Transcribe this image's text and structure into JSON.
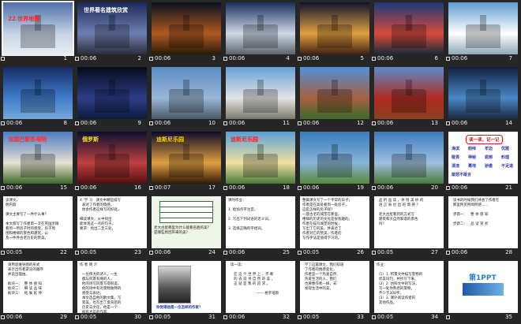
{
  "slides": [
    {
      "num": "1",
      "time": "",
      "title": "22.世界地理",
      "title_color": "#ff2020",
      "bg": [
        "#4e6fa8",
        "#c6d4e6",
        "#e9ecef"
      ]
    },
    {
      "num": "2",
      "time": "00:06",
      "title": "世界著名建筑欣赏",
      "title_color": "#ffffff",
      "bg": [
        "#1b2a5a",
        "#6f7fb1",
        "#2b2e3a"
      ]
    },
    {
      "num": "3",
      "time": "00:06",
      "bg": [
        "#08101f",
        "#b05a20",
        "#2a1a0a"
      ]
    },
    {
      "num": "4",
      "time": "00:06",
      "bg": [
        "#18305e",
        "#cfd8e7",
        "#5c636b"
      ]
    },
    {
      "num": "5",
      "time": "00:06",
      "bg": [
        "#0c1330",
        "#e0a040",
        "#402010"
      ]
    },
    {
      "num": "6",
      "time": "00:06",
      "bg": [
        "#1a3a7a",
        "#d84a3a",
        "#1a2a3a"
      ]
    },
    {
      "num": "7",
      "time": "00:06",
      "bg": [
        "#5f9ccf",
        "#ffffff",
        "#8fa9b8"
      ]
    },
    {
      "num": "8",
      "time": "00:06",
      "bg": [
        "#162c66",
        "#3f7ccc",
        "#78a8d8"
      ]
    },
    {
      "num": "9",
      "time": "00:06",
      "bg": [
        "#050b1a",
        "#2d3d8a",
        "#0d1a3a"
      ]
    },
    {
      "num": "10",
      "time": "00:06",
      "bg": [
        "#5a8cc4",
        "#9ab6d6",
        "#4a5a6a"
      ]
    },
    {
      "num": "11",
      "time": "00:06",
      "bg": [
        "#66a0d8",
        "#e4e4e4",
        "#7a7a6a"
      ]
    },
    {
      "num": "12",
      "time": "00:06",
      "bg": [
        "#4f90d8",
        "#a76040",
        "#3a6a2a"
      ]
    },
    {
      "num": "13",
      "time": "00:06",
      "bg": [
        "#5b8ccb",
        "#b02a20",
        "#8a4020"
      ]
    },
    {
      "num": "14",
      "time": "00:06",
      "bg": [
        "#102040",
        "#4a88c8",
        "#1a2840"
      ]
    },
    {
      "num": "15",
      "time": "00:06",
      "title": "法国巴黎圣母院",
      "title_color": "#ff2a2a",
      "bg": [
        "#4b7cc4",
        "#e8e0d0",
        "#3a6a2a"
      ]
    },
    {
      "num": "16",
      "time": "00:06",
      "title": "俄罗斯",
      "title_color": "#ffe000",
      "bg": [
        "#0a1030",
        "#c04040",
        "#501010"
      ]
    },
    {
      "num": "17",
      "time": "00:07",
      "title": "迪斯尼乐园",
      "title_color": "#ffd000",
      "bg": [
        "#0a0a28",
        "#e0a040",
        "#301808"
      ]
    },
    {
      "num": "18",
      "time": "00:06",
      "title": "迪斯尼乐园",
      "title_color": "#ff2020",
      "bg": [
        "#5aa0d8",
        "#f0e0a0",
        "#4a7a3a"
      ]
    },
    {
      "num": "19",
      "time": "00:06",
      "bg": [
        "#3b7abe",
        "#86b4d8",
        "#5a8a3a"
      ]
    },
    {
      "num": "20",
      "time": "00:06",
      "bg": [
        "#3b7abe",
        "#9ec0e0",
        "#4a7a3a"
      ]
    },
    {
      "num": "21",
      "time": "00:06",
      "type": "words",
      "head": "读一读，记一记",
      "words": [
        "海滨",
        "韵味",
        "年迈",
        "优雅",
        "敬畏",
        "神秘",
        "遐想",
        "料理",
        "漂流",
        "蓦地",
        "骄傲",
        "不足道",
        "敢怒不敢言"
      ]
    },
    {
      "num": "22",
      "time": "00:05",
      "type": "text",
      "text": "读课文，\n明内容\n\n课文主要写了一件什么事？\n\n本文叙写了作者第一次在英国亲眼\n看到一所房子时的感受，房子周\n围和楼梯的景色和建筑，以\n及一件件古老历史的赞美。"
    },
    {
      "num": "23",
      "time": "00:05",
      "type": "text",
      "text": "4. 学 习   课文中哪些描写\n  表达了作者的情感，\n  体会作者这样写的好处。\n\n细读课文，从中找出\n能体现这一点的句子。\n要求：找出二至三处。"
    },
    {
      "num": "24",
      "time": "00:06",
      "type": "table",
      "text": "老大古屋哪里为什么能看名胜的美？\n是哪些原因带来的美？"
    },
    {
      "num": "25",
      "time": "00:06",
      "type": "text",
      "text": "课时作业：\n\n1. 给加点字注音。\n\n2. 写出下列词语的近义词。\n\n3. 选择正确的字组词。"
    },
    {
      "num": "26",
      "time": "00:05",
      "type": "text",
      "text": "整篇课文写了一个平常的日子，\n作者是在高处看到一处房子，\n这是怎样的房子呢？\n一座古老的城堡在那里。\n楼梯的历史的文化是很有趣的。\n作者在描写城堡的时候，\n写出了它的美，并表达了\n作者对它的赞美，作者的\n写作手法是值得学习的。"
    },
    {
      "num": "27",
      "time": "00:05",
      "type": "text",
      "text": "  品 析 品 读 ，体 悟 美 妙 的\n  语 言 表 达 出 的 情 感 ？\n\n  老大古屋看到的方式写\n  建筑和大自然和谐的景色\n  吗？"
    },
    {
      "num": "28",
      "time": "00:06",
      "type": "text",
      "text": "  读书的时候我们体会了作者在\n  那里所见所闻所感……\n\n  步骤一：   整 体 感 知\n\n  步骤二：   品 读 赏 析"
    },
    {
      "num": "29",
      "time": "00:06",
      "type": "text",
      "text": "  请用思维导图的形式\n  表示出作者游览的顺序\n  并说出理由。\n\n  板块一：  整 体 感 知\n  板块二：  细 读 品 味\n  板块三：  拓 展 延 伸"
    },
    {
      "num": "30",
      "time": "00:05",
      "type": "text",
      "text": "作 者 简 介\n\n  一位伟大的诗人，一生\n  都与风景有缘的人。\n  他的诗写风景写得很美，\n  他的诗中有对景物独特的\n  感受与表达。\n  本文选自他的散文集，写\n  景美，也写出了景背后的\n  历史与文化，他是一个\n  很有才华的作家。"
    },
    {
      "num": "31",
      "time": "00:05",
      "type": "portrait",
      "caption": "你觉得他是一位怎样的作家？"
    },
    {
      "num": "32",
      "time": "00:06",
      "type": "text",
      "text": "  读一读：\n\n     在 这 个 世 界 上 ，不 断\n     的 去 追 寻 自 然 的 美 ，\n     这 就 是 我 的 追 求 。\n\n                         —— 格罗培斯"
    },
    {
      "num": "33",
      "time": "00:05",
      "type": "text",
      "text": "  学了这篇课文，我们知道\n  了作者的情感变化，\n  作者是一个热爱自然、\n  热爱生活的人，我们\n  也要像作者一样，去\n  发现生活中的美。"
    },
    {
      "num": "34",
      "time": "00:05",
      "type": "text",
      "text": "作业：\n\n（1）1. 积累文中描写景物的\n  优美词句，并抄写下来。\n（2）2. 仿照文中的写法，\n  写一处你熟悉的景物，\n  不少于300字。\n（3）3. 课外阅读作者的\n  其他作品。"
    },
    {
      "num": "35",
      "time": "",
      "type": "logo",
      "logo": "第1PPT"
    }
  ]
}
